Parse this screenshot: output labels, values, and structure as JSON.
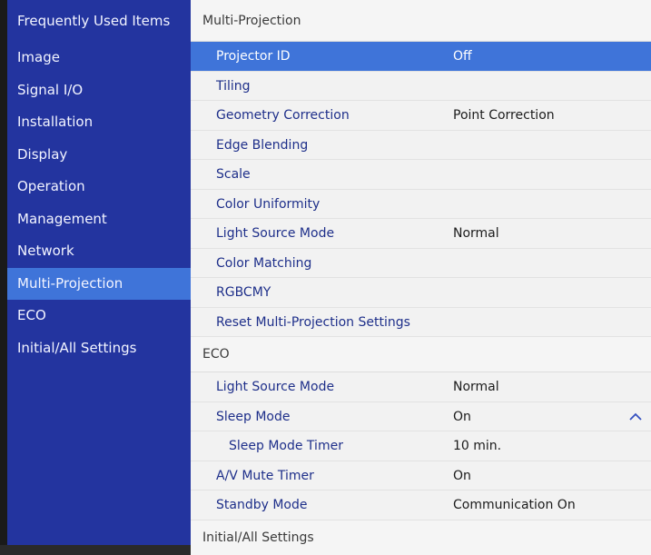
{
  "sidebar": {
    "items": [
      {
        "label": "Frequently Used Items"
      },
      {
        "label": "Image"
      },
      {
        "label": "Signal I/O"
      },
      {
        "label": "Installation"
      },
      {
        "label": "Display"
      },
      {
        "label": "Operation"
      },
      {
        "label": "Management"
      },
      {
        "label": "Network"
      },
      {
        "label": "Multi-Projection"
      },
      {
        "label": "ECO"
      },
      {
        "label": "Initial/All Settings"
      }
    ]
  },
  "main": {
    "multi_projection": {
      "header": "Multi-Projection",
      "rows": [
        {
          "label": "Projector ID",
          "value": "Off"
        },
        {
          "label": "Tiling",
          "value": ""
        },
        {
          "label": "Geometry Correction",
          "value": "Point Correction"
        },
        {
          "label": "Edge Blending",
          "value": ""
        },
        {
          "label": "Scale",
          "value": ""
        },
        {
          "label": "Color Uniformity",
          "value": ""
        },
        {
          "label": "Light Source Mode",
          "value": "Normal"
        },
        {
          "label": "Color Matching",
          "value": ""
        },
        {
          "label": "RGBCMY",
          "value": ""
        },
        {
          "label": "Reset Multi-Projection Settings",
          "value": ""
        }
      ]
    },
    "eco": {
      "header": "ECO",
      "rows": [
        {
          "label": "Light Source Mode",
          "value": "Normal"
        },
        {
          "label": "Sleep Mode",
          "value": "On"
        },
        {
          "label": "Sleep Mode Timer",
          "value": "10 min."
        },
        {
          "label": "A/V Mute Timer",
          "value": "On"
        },
        {
          "label": "Standby Mode",
          "value": "Communication On"
        }
      ]
    },
    "initial_settings": {
      "header": "Initial/All Settings"
    }
  },
  "icons": {
    "expand": "chevron-up-icon"
  },
  "colors": {
    "sidebar_bg": "#23349f",
    "selection": "#3f74d9",
    "content_bg": "#f2f2f2",
    "item_text": "#1e2f8a"
  }
}
